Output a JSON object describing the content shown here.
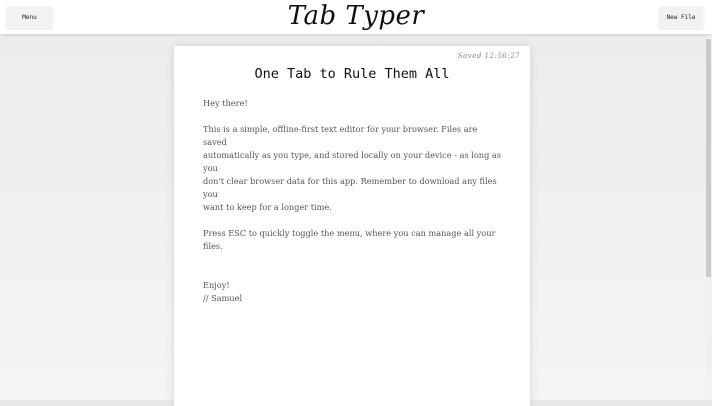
{
  "app": {
    "logo": "Tab Typer"
  },
  "toolbar": {
    "menu_label": "Menu",
    "new_file_label": "New File"
  },
  "document": {
    "saved_status": "Saved 12:56:27",
    "title": "One Tab to Rule Them All",
    "body": "Hey there!\n\nThis is a simple, offline-first text editor for your browser. Files are saved\nautomatically as you type, and stored locally on your device - as long as you\ndon't clear browser data for this app. Remember to download any files you\nwant to keep for a longer time.\n\nPress ESC to quickly toggle the menu, where you can manage all your files.\n\n\nEnjoy!\n// Samuel"
  }
}
